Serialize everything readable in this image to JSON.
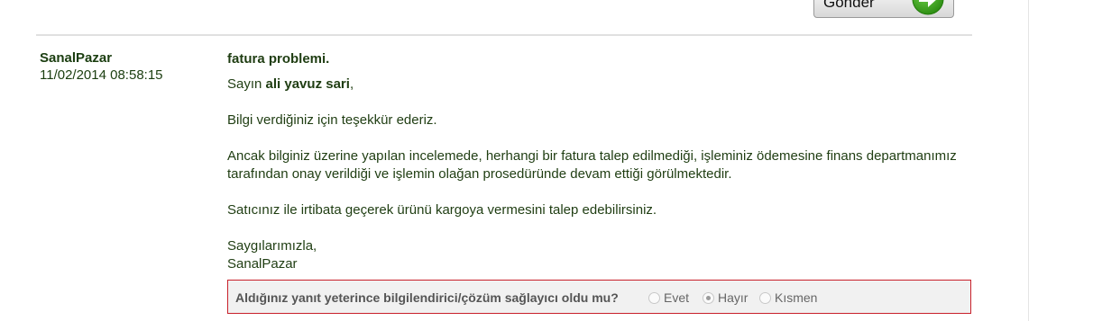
{
  "toolbar": {
    "send_label": "Gönder"
  },
  "message": {
    "author": "SanalPazar",
    "datetime": "11/02/2014 08:58:15",
    "subject": "fatura problemi.",
    "greeting_prefix": "Sayın",
    "recipient_name": "ali yavuz sari",
    "greeting_suffix": ",",
    "paragraph_1": "Bilgi verdiğiniz için teşekkür ederiz.",
    "paragraph_2": "Ancak bilginiz üzerine yapılan incelemede, herhangi bir fatura talep edilmediği, işleminiz ödemesine finans departmanımız tarafından onay verildiği ve işlemin olağan prosedüründe devam ettiği görülmektedir.",
    "paragraph_3": "Satıcınız ile irtibata geçerek ürünü kargoya vermesini talep edebilirsiniz.",
    "closing": "Saygılarımızla,",
    "signature": "SanalPazar"
  },
  "feedback": {
    "question": "Aldığınız yanıt yeterince bilgilendirici/çözüm sağlayıcı oldu mu?",
    "options": [
      {
        "label": "Evet",
        "selected": false
      },
      {
        "label": "Hayır",
        "selected": true
      },
      {
        "label": "Kısmen",
        "selected": false
      }
    ]
  },
  "colors": {
    "text_green": "#1f3d12",
    "accent_green": "#3aa018",
    "feedback_border": "#c8202a",
    "feedback_bg": "#f1f1f1"
  },
  "icons": {
    "send_arrow": "arrow-right-icon"
  }
}
